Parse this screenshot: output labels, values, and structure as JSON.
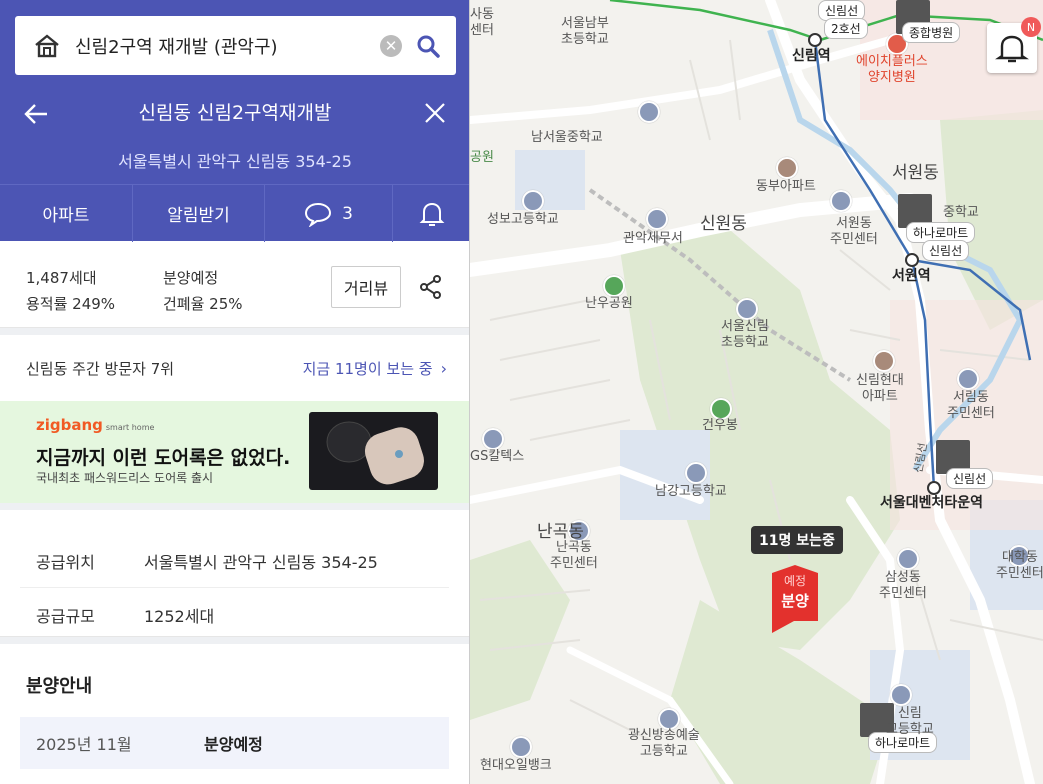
{
  "search": {
    "query": "신림2구역 재개발 (관악구)"
  },
  "header": {
    "title": "신림동 신림2구역재개발",
    "address": "서울특별시 관악구 신림동 354-25"
  },
  "tabs": [
    {
      "label": "아파트"
    },
    {
      "label": "알림받기"
    },
    {
      "label": "3"
    },
    {
      "label": ""
    }
  ],
  "info": {
    "households": "1,487세대",
    "status": "분양예정",
    "far": "용적률 249%",
    "bcr": "건폐율 25%",
    "roadview": "거리뷰"
  },
  "visitors": {
    "rank": "신림동 주간 방문자 7위",
    "watching": "지금 11명이 보는 중"
  },
  "banner": {
    "brand": "zigbang",
    "brand_sub": "smart home",
    "headline": "지금까지 이런 도어록은 없었다.",
    "sub": "국내최초 패스워드리스 도어록 출시"
  },
  "supply": [
    {
      "key": "공급위치",
      "value": "서울특별시 관악구 신림동 354-25"
    },
    {
      "key": "공급규모",
      "value": "1252세대"
    }
  ],
  "schedule": {
    "heading": "분양안내",
    "rows": [
      {
        "date": "2025년 11월",
        "value": "분양예정"
      }
    ]
  },
  "map": {
    "notification_badge": "N",
    "viewer_tag": "11명 보는중",
    "pin_small": "예정",
    "pin_big": "분양",
    "labels": [
      {
        "text": "사동\n센터"
      },
      {
        "text": "서울남부\n초등학교"
      },
      {
        "text": "신림선"
      },
      {
        "text": "2호선"
      },
      {
        "text": "신림역"
      },
      {
        "text": "종합병원"
      },
      {
        "text": "에이치플러스\n양지병원"
      },
      {
        "text": "남서울중학교"
      },
      {
        "text": "공원"
      },
      {
        "text": "동부아파트"
      },
      {
        "text": "서원동"
      },
      {
        "text": "성보고등학교"
      },
      {
        "text": "관악세무서"
      },
      {
        "text": "신원동"
      },
      {
        "text": "서원동\n주민센터"
      },
      {
        "text": "하나로마트"
      },
      {
        "text": "신림선"
      },
      {
        "text": "서원역"
      },
      {
        "text": "난우공원"
      },
      {
        "text": "서울신림\n초등학교"
      },
      {
        "text": "신림현대\n아파트"
      },
      {
        "text": "서림동\n주민센터"
      },
      {
        "text": "건우봉"
      },
      {
        "text": "GS칼텍스"
      },
      {
        "text": "신림선"
      },
      {
        "text": "남강고등학교"
      },
      {
        "text": "서울대벤처타운역"
      },
      {
        "text": "난곡동"
      },
      {
        "text": "난곡동\n주민센터"
      },
      {
        "text": "삼성동\n주민센터"
      },
      {
        "text": "대학동\n주민센터"
      },
      {
        "text": "광신방송예술\n고등학교"
      },
      {
        "text": "현대오일뱅크"
      },
      {
        "text": "하나로마트"
      },
      {
        "text": "중학교"
      },
      {
        "text": "신림\n고등학교"
      },
      {
        "text": "신림선"
      }
    ]
  }
}
